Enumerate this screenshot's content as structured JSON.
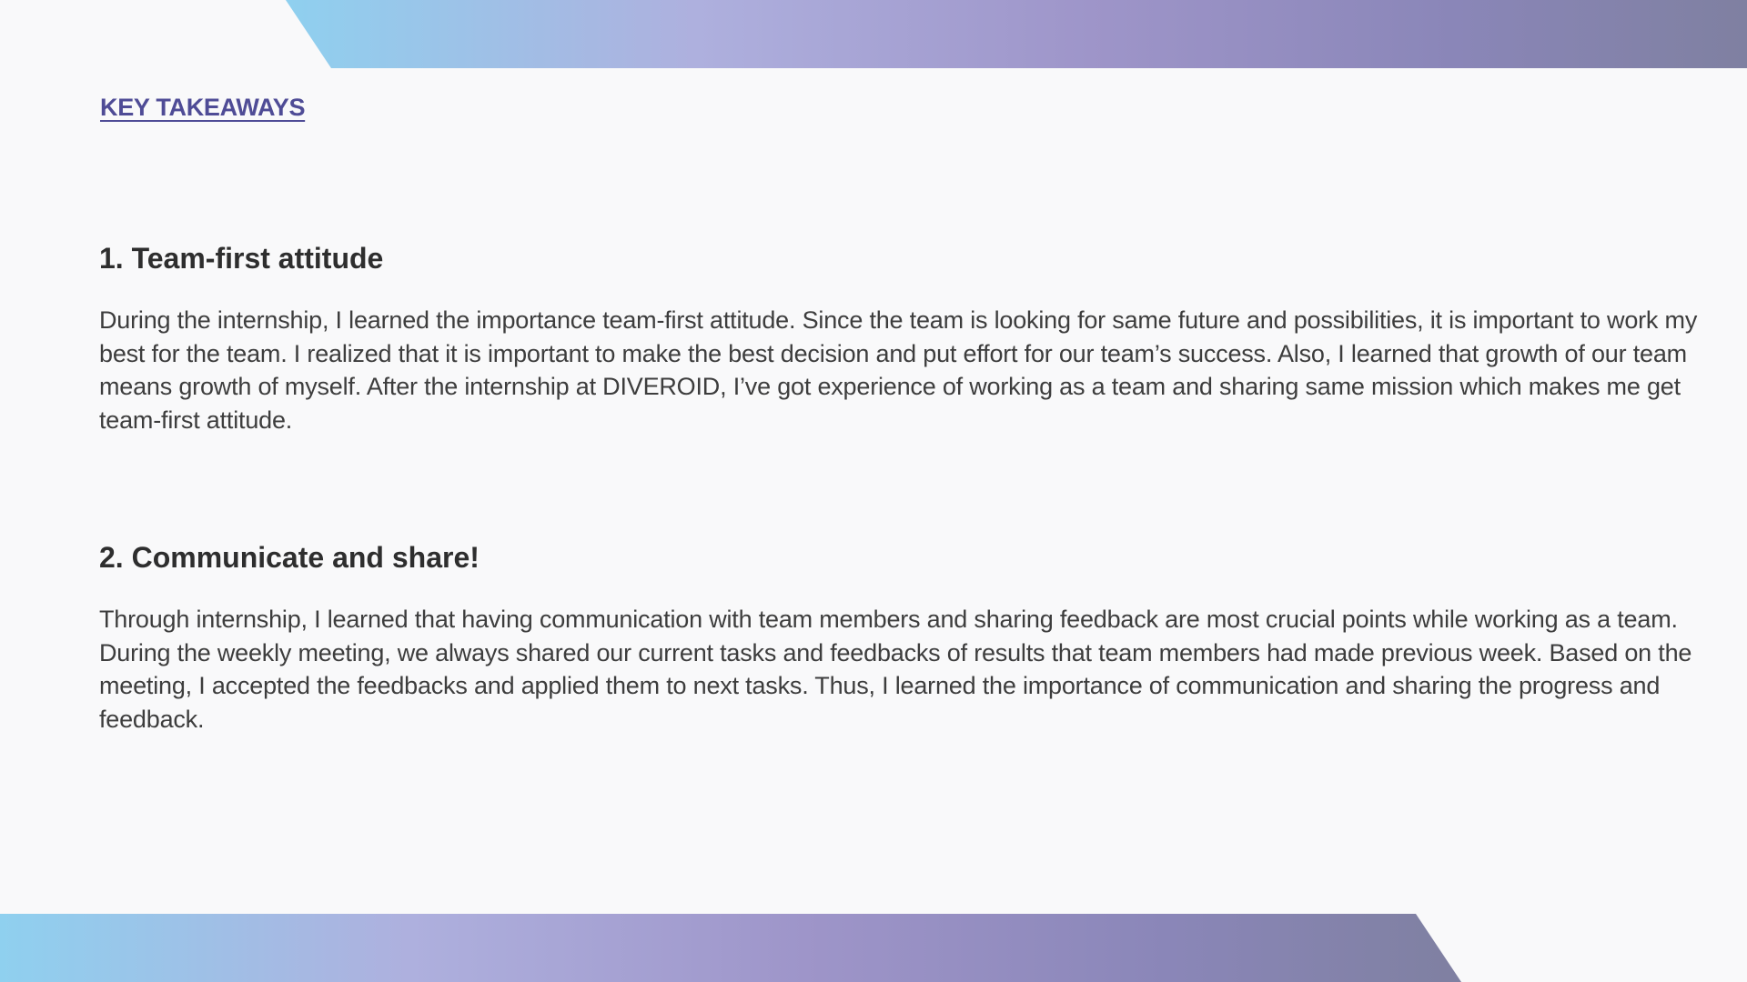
{
  "header": {
    "section_label": "KEY TAKEAWAYS"
  },
  "takeaways": [
    {
      "heading": "1. Team-first attitude",
      "body": "During the internship, I learned the importance team-first attitude. Since the team is looking for same future and possibilities, it is important to work my best for the team. I realized that it is important to make the best decision and put effort for our team’s success. Also, I learned that growth of our team means growth of myself.  After the internship at DIVEROID, I’ve got experience of working as a team and sharing same mission which makes me get team-first attitude."
    },
    {
      "heading": "2. Communicate and share!",
      "body": "Through internship, I learned that having communication with team members and sharing feedback are most crucial points while working as a team. During the weekly meeting, we always shared our current tasks and feedbacks of results that team members had made previous week. Based on the meeting, I accepted the feedbacks and applied them to next tasks. Thus, I learned the importance of communication and sharing the progress and feedback."
    }
  ],
  "colors": {
    "accent": "#4f4c96",
    "band_start": "#8fd0ef",
    "band_mid": "#aeb0de",
    "band_end": "#7f80a1"
  }
}
